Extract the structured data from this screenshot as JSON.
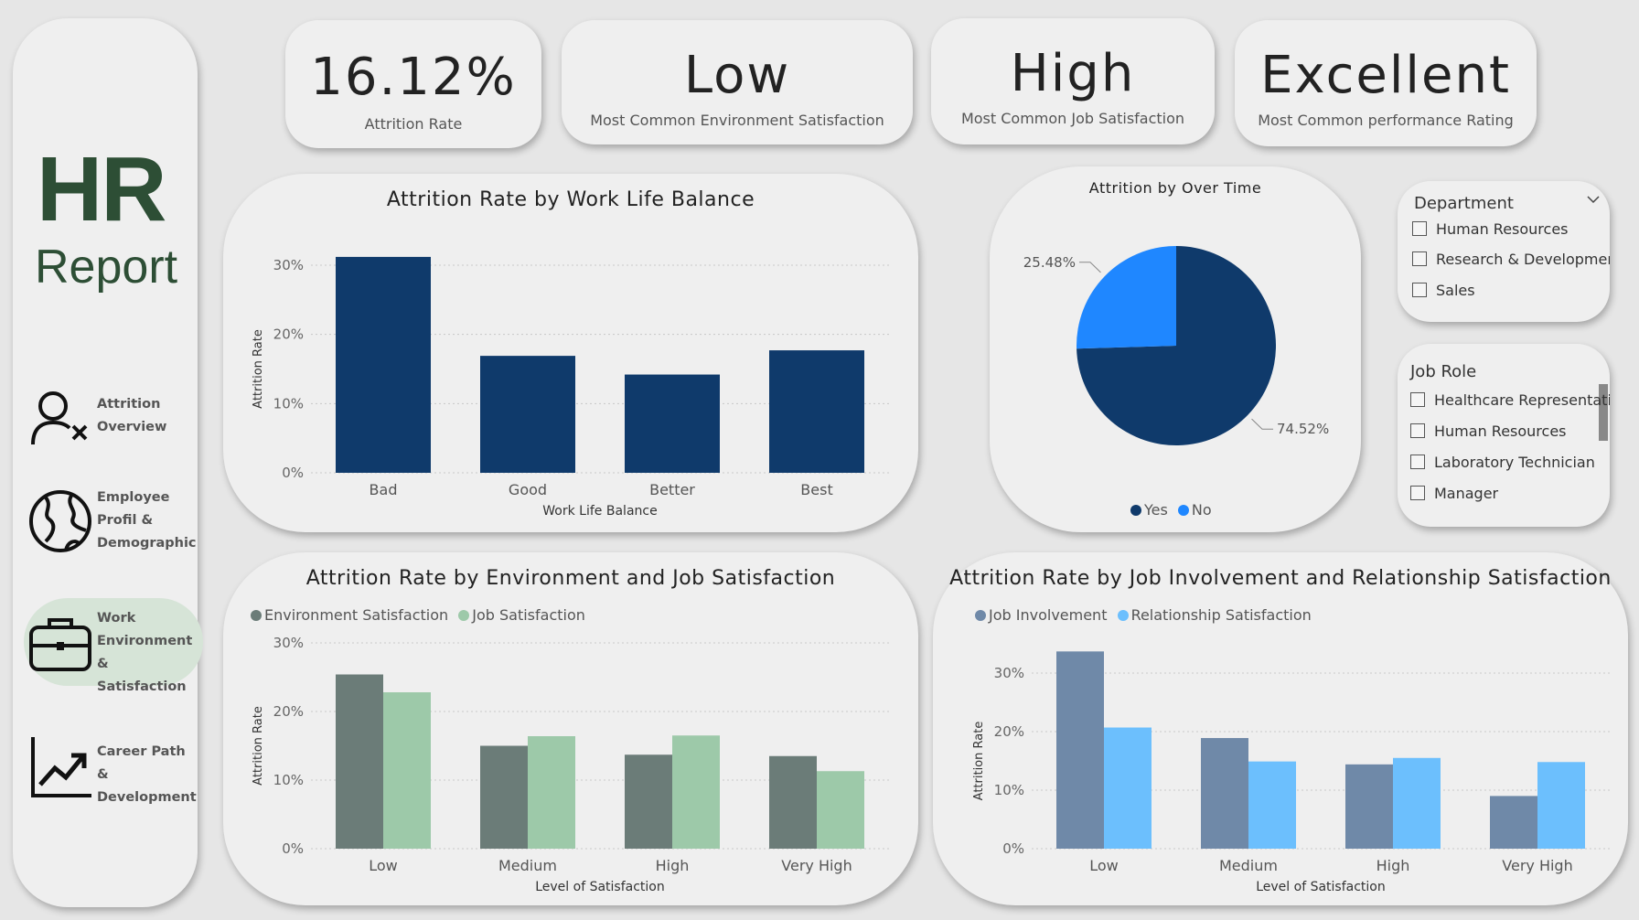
{
  "sidebar": {
    "title": "HR",
    "subtitle": "Report",
    "nav": [
      {
        "line1": "Attrition",
        "line2": "Overview",
        "line3": ""
      },
      {
        "line1": "Employee",
        "line2": "Profil &",
        "line3": "Demographic"
      },
      {
        "line1": "Work",
        "line2": "Environment &",
        "line3": "Satisfaction"
      },
      {
        "line1": "Career Path &",
        "line2": "Development",
        "line3": ""
      }
    ]
  },
  "kpis": [
    {
      "value": "16.12%",
      "caption": "Attrition Rate"
    },
    {
      "value": "Low",
      "caption": "Most Common Environment Satisfaction"
    },
    {
      "value": "High",
      "caption": "Most Common Job Satisfaction"
    },
    {
      "value": "Excellent",
      "caption": "Most Common performance Rating"
    }
  ],
  "slicers": {
    "department": {
      "title": "Department",
      "items": [
        "Human Resources",
        "Research & Development",
        "Sales"
      ]
    },
    "job_role": {
      "title": "Job Role",
      "items": [
        "Healthcare Representati",
        "Human Resources",
        "Laboratory Technician",
        "Manager"
      ]
    }
  },
  "colors": {
    "navy": "#0f3a6b",
    "pie_yes": "#0f3a6b",
    "pie_no": "#1f87ff",
    "env": "#6b7c78",
    "job": "#9dc9a9",
    "involvement": "#6f89a8",
    "relationship": "#6cbffd"
  },
  "chart_data": [
    {
      "type": "bar",
      "title": "Attrition Rate by Work Life Balance",
      "xlabel": "Work Life Balance",
      "ylabel": "Attrition Rate",
      "categories": [
        "Bad",
        "Good",
        "Better",
        "Best"
      ],
      "values": [
        31.2,
        16.9,
        14.2,
        17.7
      ],
      "yticks": [
        "0%",
        "10%",
        "20%",
        "30%"
      ],
      "ylim": [
        0,
        30
      ]
    },
    {
      "type": "pie",
      "title": "Attrition by Over Time",
      "labels": [
        "Yes",
        "No"
      ],
      "values": [
        74.52,
        25.48
      ],
      "value_labels": [
        "74.52%",
        "25.48%"
      ],
      "legend": "bottom"
    },
    {
      "type": "bar",
      "title": "Attrition Rate by Environment and Job Satisfaction",
      "xlabel": "Level of Satisfaction",
      "ylabel": "Attrition Rate",
      "categories": [
        "Low",
        "Medium",
        "High",
        "Very High"
      ],
      "series": [
        {
          "name": "Environment Satisfaction",
          "values": [
            25.4,
            15.0,
            13.7,
            13.5
          ]
        },
        {
          "name": "Job Satisfaction",
          "values": [
            22.8,
            16.4,
            16.5,
            11.3
          ]
        }
      ],
      "yticks": [
        "0%",
        "10%",
        "20%",
        "30%"
      ],
      "ylim": [
        0,
        30
      ],
      "legend": "top-left"
    },
    {
      "type": "bar",
      "title": "Attrition Rate by Job Involvement and Relationship Satisfaction",
      "xlabel": "Level of Satisfaction",
      "ylabel": "Attrition Rate",
      "categories": [
        "Low",
        "Medium",
        "High",
        "Very High"
      ],
      "series": [
        {
          "name": "Job Involvement",
          "values": [
            33.7,
            18.9,
            14.4,
            9.0
          ]
        },
        {
          "name": "Relationship Satisfaction",
          "values": [
            20.7,
            14.9,
            15.5,
            14.8
          ]
        }
      ],
      "yticks": [
        "0%",
        "10%",
        "20%",
        "30%"
      ],
      "ylim": [
        0,
        30
      ],
      "legend": "top-left"
    }
  ]
}
